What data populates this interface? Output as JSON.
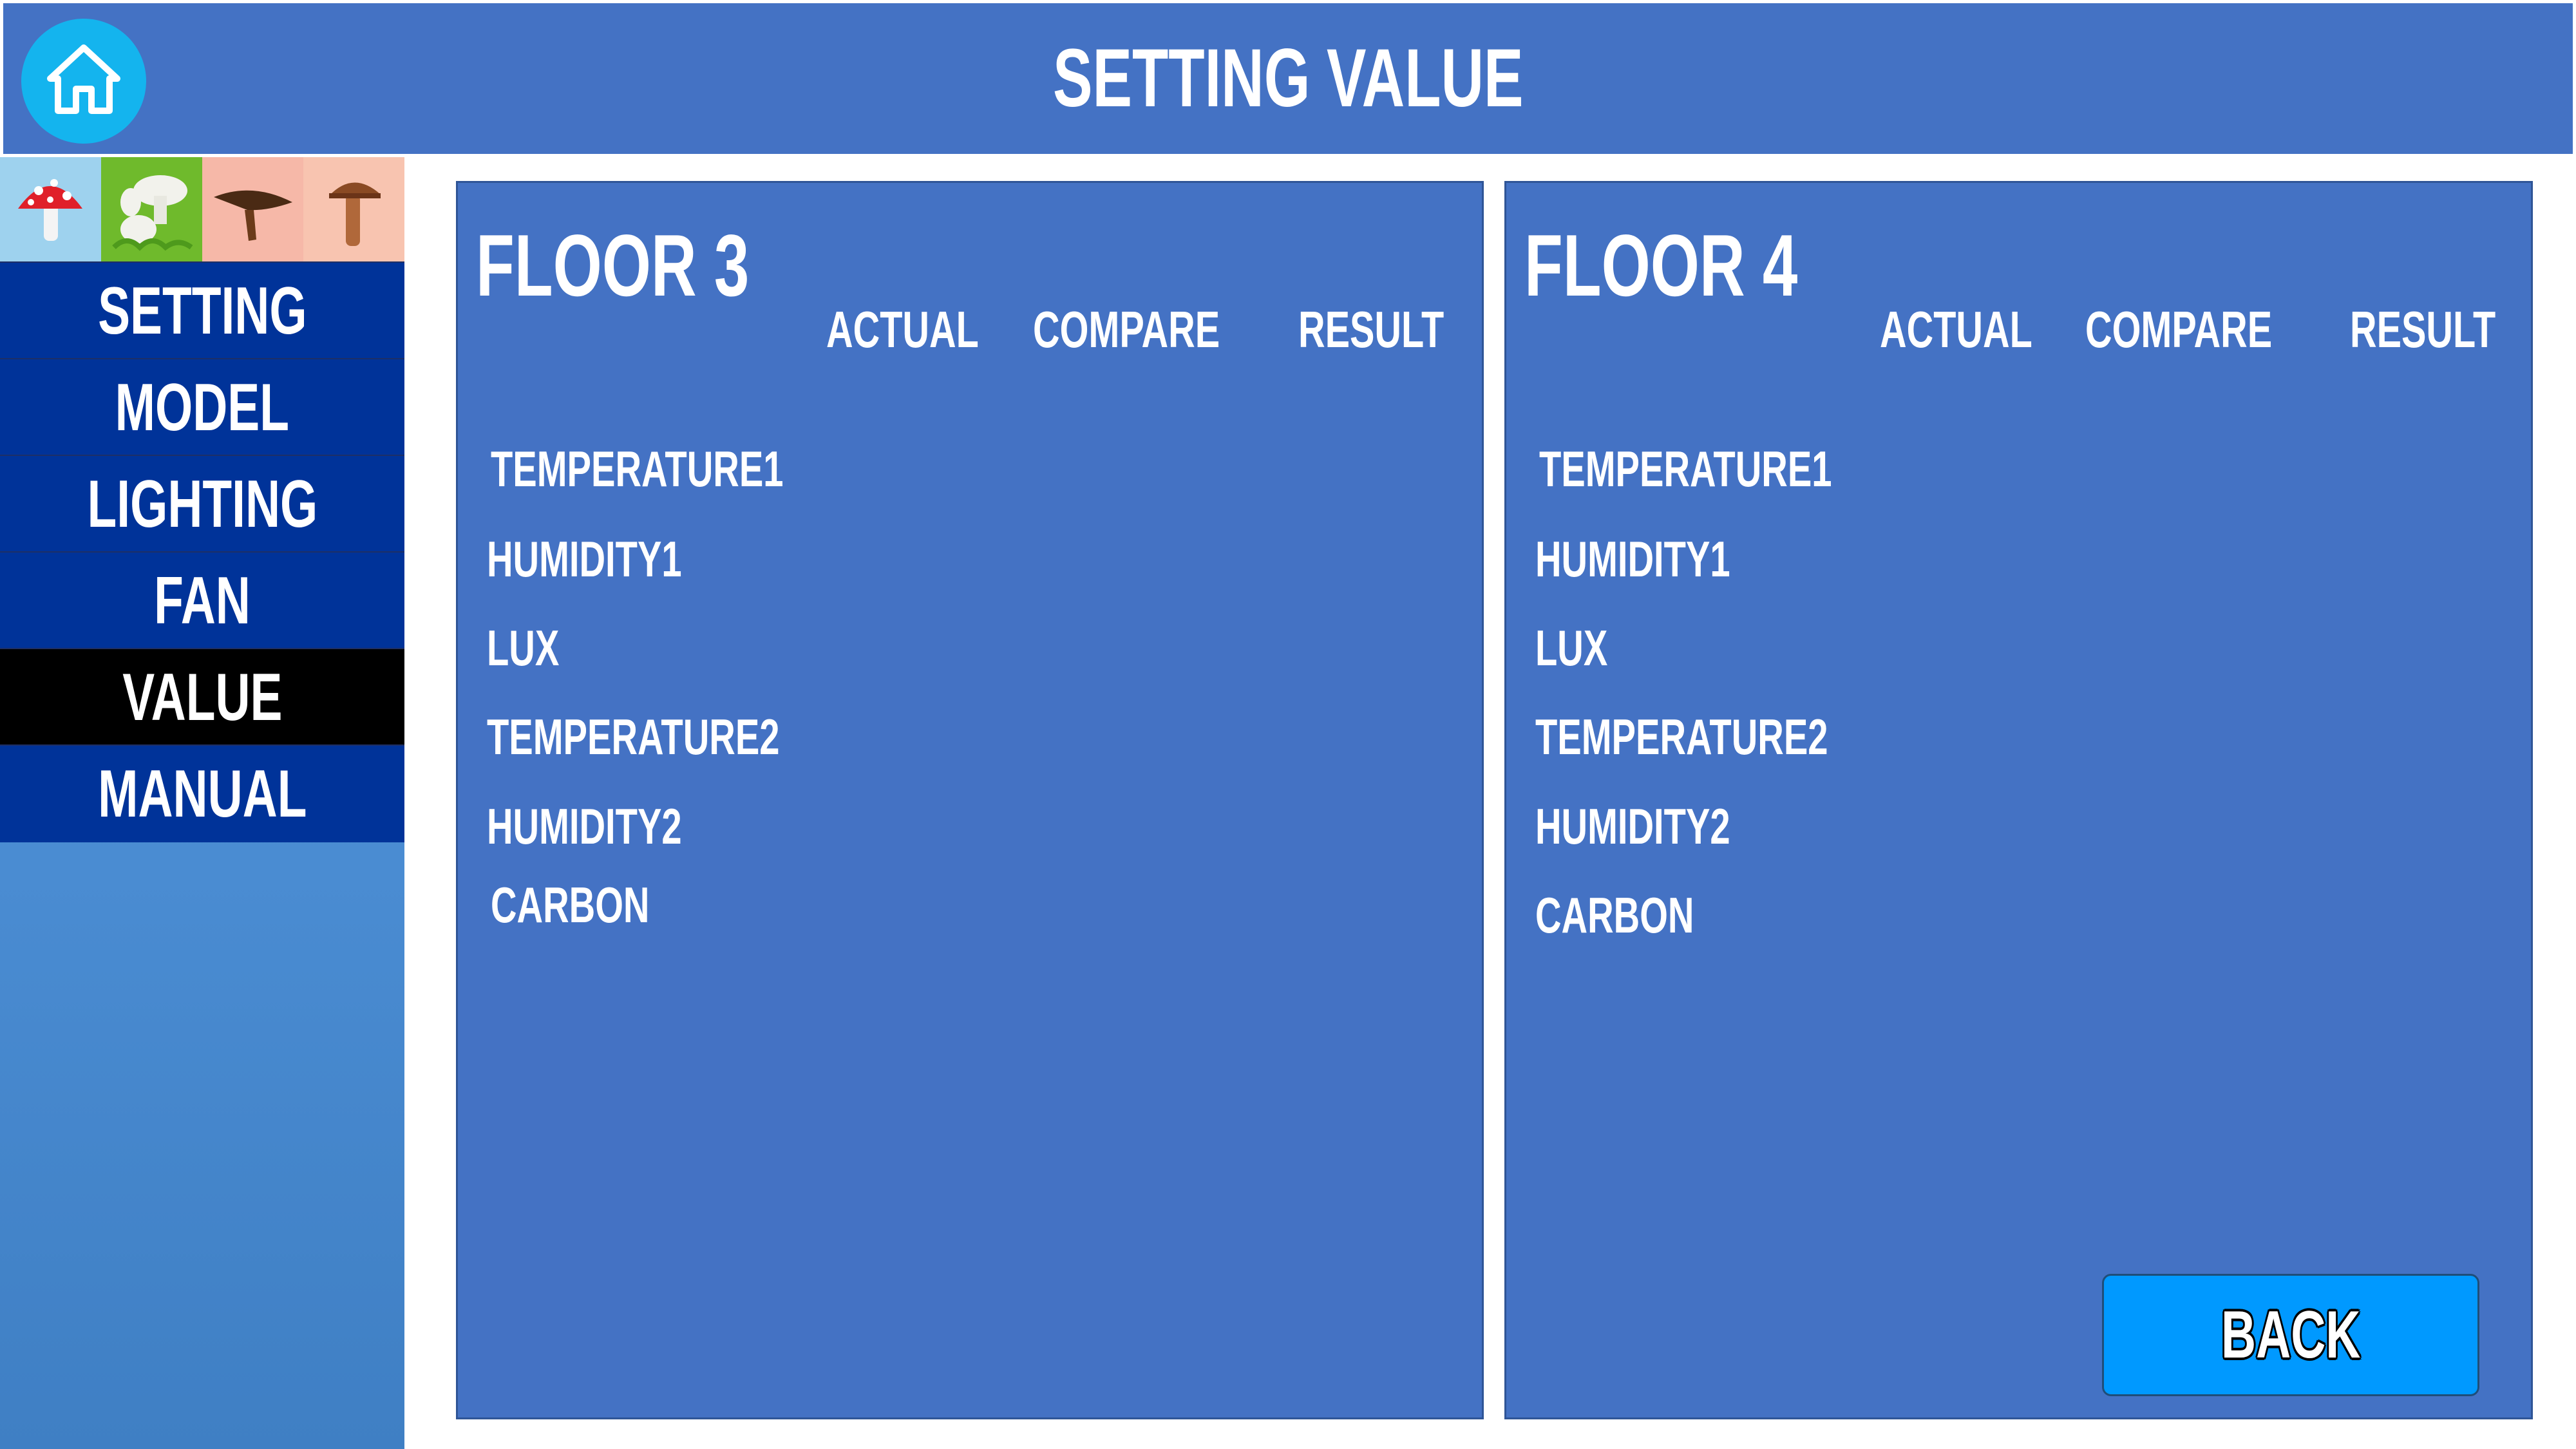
{
  "header": {
    "title": "SETTING VALUE",
    "home_icon": "home-icon"
  },
  "sidebar": {
    "icons": [
      "red-toadstool-icon",
      "white-mushrooms-icon",
      "brown-cap-mushroom-icon",
      "tall-brown-mushroom-icon"
    ],
    "items": [
      {
        "label": "SETTING",
        "active": false
      },
      {
        "label": "MODEL",
        "active": false
      },
      {
        "label": "LIGHTING",
        "active": false
      },
      {
        "label": "FAN",
        "active": false
      },
      {
        "label": "VALUE",
        "active": true
      },
      {
        "label": "MANUAL",
        "active": false
      }
    ]
  },
  "panels": [
    {
      "title": "FLOOR 3",
      "columns": [
        "ACTUAL",
        "COMPARE",
        "RESULT"
      ],
      "rows": [
        "TEMPERATURE1",
        "HUMIDITY1",
        "LUX",
        "TEMPERATURE2",
        "HUMIDITY2",
        "CARBON"
      ]
    },
    {
      "title": "FLOOR 4",
      "columns": [
        "ACTUAL",
        "COMPARE",
        "RESULT"
      ],
      "rows": [
        "TEMPERATURE1",
        "HUMIDITY1",
        "LUX",
        "TEMPERATURE2",
        "HUMIDITY2",
        "CARBON"
      ]
    }
  ],
  "back_button": {
    "label": "BACK"
  },
  "colors": {
    "header_bg": "#4472c4",
    "panel_bg": "#4472c4",
    "nav_bg": "#003399",
    "nav_active_bg": "#000000",
    "home_button": "#14b4ee",
    "back_button": "#0099ff"
  }
}
